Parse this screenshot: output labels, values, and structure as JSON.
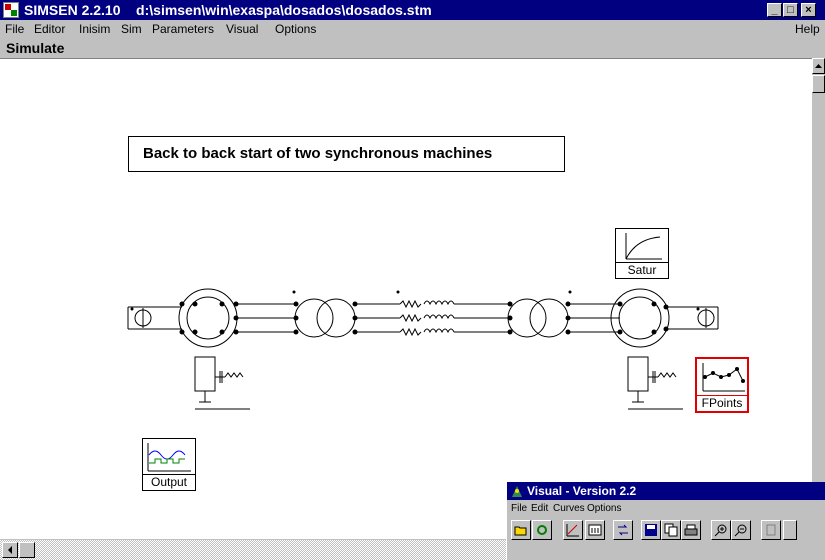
{
  "window": {
    "title": "SIMSEN 2.2.10    d:\\simsen\\win\\exaspa\\dosados\\dosados.stm",
    "buttons": {
      "minimize": "_",
      "maximize": "□",
      "close": "×"
    }
  },
  "menu": {
    "file": "File",
    "editor": "Editor",
    "inisim": "Inisim",
    "sim": "Sim",
    "parameters": "Parameters",
    "visual": "Visual",
    "options": "Options",
    "help": "Help"
  },
  "panel": {
    "title": "Simulate"
  },
  "diagram": {
    "title": "Back to back start of two synchronous machines",
    "blocks": {
      "satur": "Satur",
      "fpoints": "FPoints",
      "output": "Output"
    }
  },
  "visual_window": {
    "title": "Visual - Version 2.2",
    "menu": {
      "file": "File",
      "edit": "Edit",
      "curves": "Curves",
      "options": "Options"
    }
  }
}
